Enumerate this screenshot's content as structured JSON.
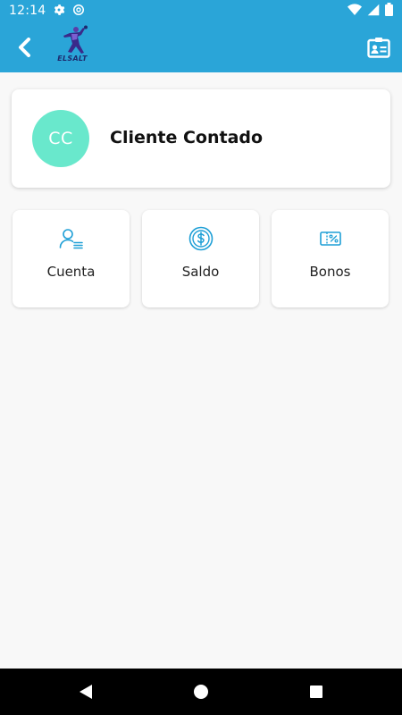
{
  "status_bar": {
    "time": "12:14",
    "left_icons": [
      "gear-icon",
      "at-sign-icon"
    ],
    "right_icons": [
      "wifi-icon",
      "signal-icon",
      "battery-icon"
    ]
  },
  "app_bar": {
    "color": "#2aa5d8",
    "back_icon": "chevron-left-icon",
    "logo_text": "ELSALT",
    "action_icon": "contact-card-icon"
  },
  "profile": {
    "initials": "CC",
    "name": "Cliente Contado",
    "avatar_color": "#69e8cc"
  },
  "tiles": [
    {
      "label": "Cuenta",
      "icon": "user-list-icon"
    },
    {
      "label": "Saldo",
      "icon": "dollar-coin-icon"
    },
    {
      "label": "Bonos",
      "icon": "percent-ticket-icon"
    }
  ],
  "nav": {
    "icons": [
      "back-triangle-icon",
      "home-circle-icon",
      "recents-square-icon"
    ]
  },
  "colors": {
    "accent": "#2aa5d8",
    "icon_blue": "#1e9fd6",
    "background": "#f8f8f8"
  }
}
